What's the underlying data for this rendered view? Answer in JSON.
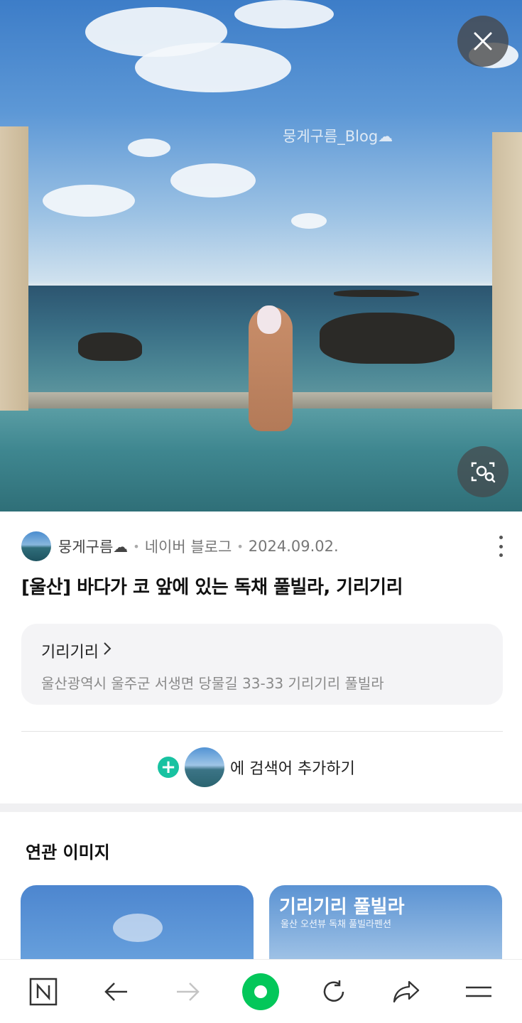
{
  "hero": {
    "watermark": "뭉게구름_Blog☁"
  },
  "post": {
    "blog_name": "뭉게구름☁",
    "platform": "네이버 블로그",
    "date": "2024.09.02.",
    "title": "[울산] 바다가 코 앞에 있는 독채 풀빌라, 기리기리"
  },
  "place": {
    "name": "기리기리",
    "address": "울산광역시 울주군 서생면 당물길 33-33 기리기리 풀빌라"
  },
  "add_search": {
    "label": "에 검색어 추가하기"
  },
  "related": {
    "heading": "연관 이미지",
    "card2_title": "기리기리 풀빌라",
    "card2_subtitle": "울산 오션뷰 독채 풀빌라펜션"
  },
  "icons": {
    "close": "close-icon",
    "lens": "image-search-icon",
    "more": "more-vertical-icon",
    "plus": "plus-icon",
    "nav": [
      "naver-n-icon",
      "back-arrow-icon",
      "forward-arrow-icon",
      "green-dot-icon",
      "refresh-icon",
      "share-icon",
      "menu-icon"
    ]
  },
  "colors": {
    "accent_green": "#03c75a",
    "plus_teal": "#18c2a1"
  }
}
